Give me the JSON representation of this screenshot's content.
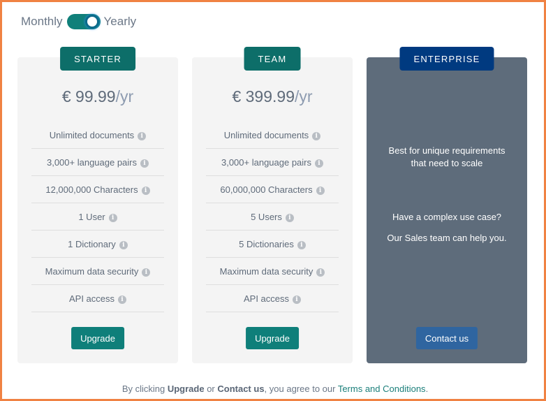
{
  "billing": {
    "monthly_label": "Monthly",
    "yearly_label": "Yearly",
    "selected": "Yearly"
  },
  "colors": {
    "frame_border": "#f08243",
    "primary_teal": "#0f7f7a",
    "enterprise_bg": "#5e6c7b",
    "enterprise_badge": "#003a80",
    "contact_button": "#2f65a0"
  },
  "plans": [
    {
      "name": "STARTER",
      "price": "€ 99.99",
      "period": "/yr",
      "features": [
        "Unlimited documents",
        "3,000+ language pairs",
        "12,000,000 Characters",
        "1 User",
        "1 Dictionary",
        "Maximum data security",
        "API access"
      ],
      "button": "Upgrade"
    },
    {
      "name": "TEAM",
      "price": "€ 399.99",
      "period": "/yr",
      "features": [
        "Unlimited documents",
        "3,000+ language pairs",
        "60,000,000 Characters",
        "5 Users",
        "5 Dictionaries",
        "Maximum data security",
        "API access"
      ],
      "button": "Upgrade"
    },
    {
      "name": "ENTERPRISE",
      "tagline_line1": "Best for unique requirements",
      "tagline_line2": "that need to scale",
      "question": "Have a complex use case?",
      "help": "Our Sales team can help you.",
      "button": "Contact us"
    }
  ],
  "icons": {
    "info": "info-circle-icon"
  },
  "footer": {
    "prefix": "By clicking ",
    "upgrade": "Upgrade",
    "or": " or ",
    "contact": "Contact us",
    "middle": ", you agree to our ",
    "link": "Terms and Conditions",
    "suffix": "."
  }
}
